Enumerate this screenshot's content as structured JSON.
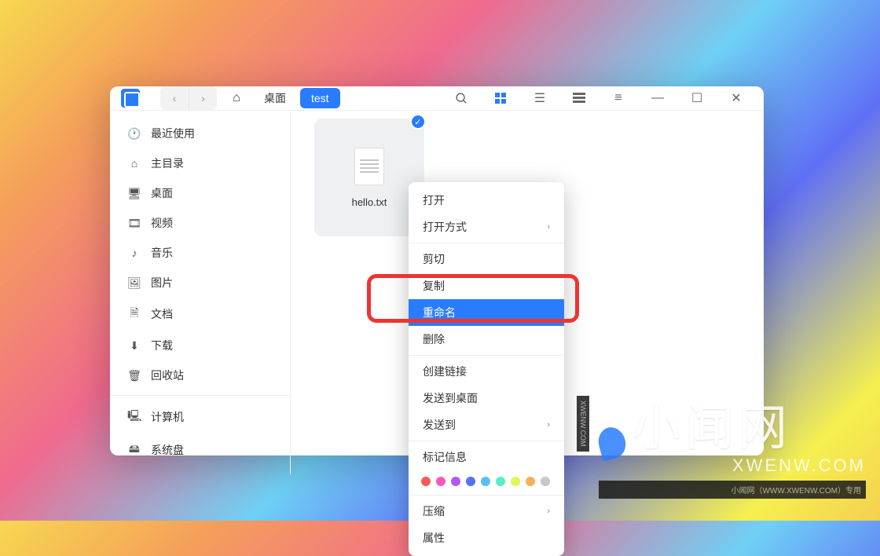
{
  "breadcrumb": {
    "parent": "桌面",
    "current": "test"
  },
  "sidebar": {
    "items": [
      {
        "icon": "🕐",
        "label": "最近使用"
      },
      {
        "icon": "⌂",
        "label": "主目录"
      },
      {
        "icon": "🖥",
        "label": "桌面"
      },
      {
        "icon": "🎞",
        "label": "视频"
      },
      {
        "icon": "♪",
        "label": "音乐"
      },
      {
        "icon": "🖼",
        "label": "图片"
      },
      {
        "icon": "🗎",
        "label": "文档"
      },
      {
        "icon": "⬇",
        "label": "下载"
      },
      {
        "icon": "🗑",
        "label": "回收站"
      },
      {
        "icon": "🖳",
        "label": "计算机"
      },
      {
        "icon": "🖴",
        "label": "系统盘"
      }
    ]
  },
  "file": {
    "name": "hello.txt",
    "selected": true
  },
  "context_menu": {
    "groups": [
      [
        {
          "label": "打开"
        },
        {
          "label": "打开方式",
          "submenu": true
        }
      ],
      [
        {
          "label": "剪切"
        },
        {
          "label": "复制"
        },
        {
          "label": "重命名",
          "selected": true
        },
        {
          "label": "删除"
        }
      ],
      [
        {
          "label": "创建链接"
        },
        {
          "label": "发送到桌面"
        },
        {
          "label": "发送到",
          "submenu": true
        }
      ],
      [
        {
          "label": "标记信息"
        }
      ],
      [
        {
          "label": "压缩",
          "submenu": true
        },
        {
          "label": "属性"
        }
      ]
    ],
    "colors": [
      "#f85a5a",
      "#f858c2",
      "#b058f8",
      "#5870f8",
      "#58c0f8",
      "#58f0c0",
      "#e0f858",
      "#f8b058",
      "#c8c8c8"
    ]
  },
  "watermark": {
    "brand_cn": "小闻网",
    "url": "XWENW.COM",
    "side": "XWENW.COM",
    "footer_right": "小闻网（WWW.XWENW.COM）专用"
  }
}
